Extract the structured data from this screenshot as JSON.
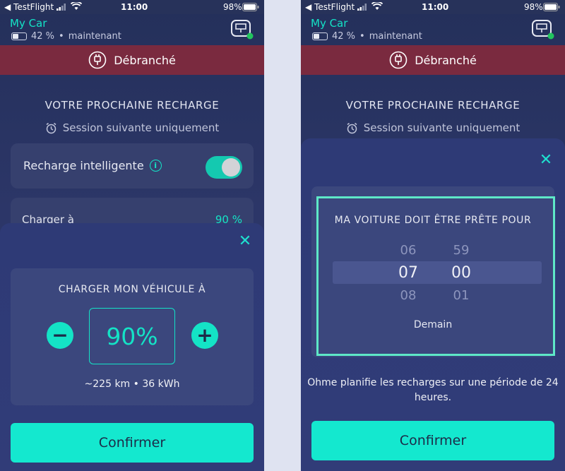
{
  "status_bar": {
    "back_app": "TestFlight",
    "time": "11:00",
    "battery_pct": "98%"
  },
  "car": {
    "name": "My Car",
    "battery": "42 %",
    "updated": "maintenant",
    "battery_level": 0.42
  },
  "banner": {
    "label": "Débranché",
    "color": "#7a2a3f"
  },
  "next_charge": {
    "title": "VOTRE PROCHAINE RECHARGE",
    "subtitle": "Session suivante uniquement"
  },
  "smart_charging": {
    "label": "Recharge intelligente",
    "enabled": true
  },
  "charge_at": {
    "label": "Charger à",
    "value": "90 %"
  },
  "charge_sheet": {
    "title": "CHARGER MON VÉHICULE À",
    "value": "90%",
    "range": "~225 km • 36 kWh",
    "minus": "−",
    "plus": "+",
    "close": "✕",
    "confirm": "Confirmer"
  },
  "ready_sheet": {
    "title": "MA VOITURE DOIT ÊTRE PRÊTE POUR",
    "hours": {
      "prev": "06",
      "current": "07",
      "next": "08"
    },
    "minutes": {
      "prev": "59",
      "current": "00",
      "next": "01"
    },
    "day": "Demain",
    "note": "Ohme planifie les recharges sur une période de 24 heures.",
    "close": "✕",
    "confirm": "Confirmer"
  },
  "colors": {
    "accent": "#14e3c6",
    "background": "#2c3668",
    "banner": "#7a2a3f"
  }
}
